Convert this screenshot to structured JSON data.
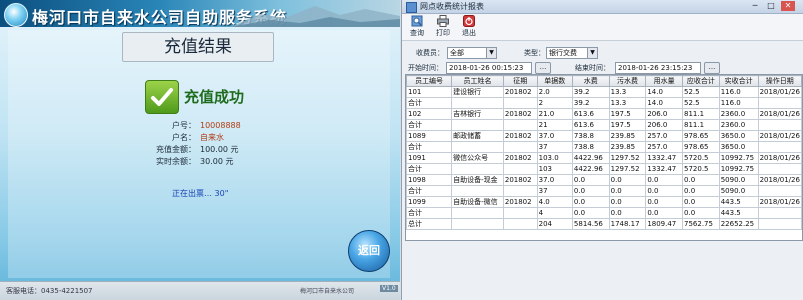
{
  "kiosk": {
    "title": "梅河口市自来水公司自助服务系统",
    "banner": "充值结果",
    "success": "充值成功",
    "fields": [
      {
        "label": "户号：",
        "value": "10008888"
      },
      {
        "label": "户名：",
        "value": "自来水"
      },
      {
        "label": "充值金额：",
        "value": "100.00 元"
      },
      {
        "label": "实时余额：",
        "value": "30.00 元"
      }
    ],
    "waiting": "正在出票… 30\"",
    "back_label": "返回",
    "footer_phone": "客服电话：0435-4221507",
    "footer_company": "梅河口市自来水公司",
    "footer_version": "V1.0"
  },
  "window": {
    "title": "网点收费统计报表",
    "toolbar": {
      "query": "查询",
      "print": "打印",
      "exit": "退出"
    },
    "filters": {
      "collector_label": "收费员：",
      "collector_value": "全部",
      "type_label": "类型：",
      "type_value": "银行交费",
      "start_label": "开始时间：",
      "start_value": "2018-01-26 00:15:23",
      "end_label": "结束时间：",
      "end_value": "2018-01-26 23:15:23",
      "picker": "..."
    },
    "table": {
      "headers": [
        "员工编号",
        "员工姓名",
        "征期",
        "单据数",
        "水费",
        "污水费",
        "用水量",
        "应收合计",
        "实收合计",
        "操作日期"
      ],
      "rows": [
        [
          "101",
          "建设银行",
          "201802",
          "2.0",
          "39.2",
          "13.3",
          "14.0",
          "52.5",
          "116.0",
          "2018/01/26"
        ],
        [
          "合计",
          "",
          "",
          "2",
          "39.2",
          "13.3",
          "14.0",
          "52.5",
          "116.0",
          ""
        ],
        [
          "102",
          "吉林银行",
          "201802",
          "21.0",
          "613.6",
          "197.5",
          "206.0",
          "811.1",
          "2360.0",
          "2018/01/26"
        ],
        [
          "合计",
          "",
          "",
          "21",
          "613.6",
          "197.5",
          "206.0",
          "811.1",
          "2360.0",
          ""
        ],
        [
          "1089",
          "邮政储蓄",
          "201802",
          "37.0",
          "738.8",
          "239.85",
          "257.0",
          "978.65",
          "3650.0",
          "2018/01/26"
        ],
        [
          "合计",
          "",
          "",
          "37",
          "738.8",
          "239.85",
          "257.0",
          "978.65",
          "3650.0",
          ""
        ],
        [
          "1091",
          "微信公众号",
          "201802",
          "103.0",
          "4422.96",
          "1297.52",
          "1332.47",
          "5720.5",
          "10992.75",
          "2018/01/26"
        ],
        [
          "合计",
          "",
          "",
          "103",
          "4422.96",
          "1297.52",
          "1332.47",
          "5720.5",
          "10992.75",
          ""
        ],
        [
          "1098",
          "自助设备-现金",
          "201802",
          "37.0",
          "0.0",
          "0.0",
          "0.0",
          "0.0",
          "5090.0",
          "2018/01/26"
        ],
        [
          "合计",
          "",
          "",
          "37",
          "0.0",
          "0.0",
          "0.0",
          "0.0",
          "5090.0",
          ""
        ],
        [
          "1099",
          "自助设备-微信",
          "201802",
          "4.0",
          "0.0",
          "0.0",
          "0.0",
          "0.0",
          "443.5",
          "2018/01/26"
        ],
        [
          "合计",
          "",
          "",
          "4",
          "0.0",
          "0.0",
          "0.0",
          "0.0",
          "443.5",
          ""
        ],
        [
          "总计",
          "",
          "",
          "204",
          "5814.56",
          "1748.17",
          "1809.47",
          "7562.75",
          "22652.25",
          ""
        ]
      ]
    }
  }
}
